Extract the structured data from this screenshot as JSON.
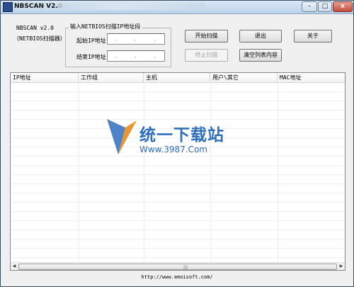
{
  "window": {
    "title": "NBSCAN V2.0",
    "controls": {
      "minimize": "–",
      "maximize": "□",
      "close": "x"
    }
  },
  "app_info": {
    "name": "NBSCAN v2.0",
    "subtitle": "（NETBIOS扫描器）"
  },
  "ip_group": {
    "title": "输入NETBIOS扫描IP地址段",
    "start_label": "起始IP地址",
    "end_label": "结束IP地址",
    "start_value": ".  .  .",
    "end_value": ".  .  ."
  },
  "buttons": {
    "start_scan": "开始扫描",
    "stop_scan": "终止扫描",
    "exit": "退出",
    "clear_list": "清空列表内容",
    "about": "关于"
  },
  "table": {
    "columns": [
      "IP地址",
      "工作组",
      "主机",
      "用户\\其它",
      "MAC地址"
    ]
  },
  "watermark": {
    "title": "统一下载站",
    "url": "Www.3987.Com"
  },
  "footer": {
    "url": "http://www.amoisoft.com/"
  },
  "colors": {
    "accent": "#2f6dbd",
    "titlebar": "#c9dbee",
    "close_button": "#c54b3a"
  }
}
